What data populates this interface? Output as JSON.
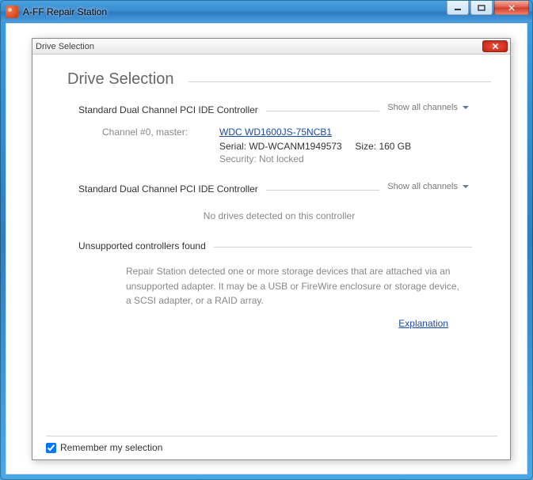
{
  "outer": {
    "title": "A-FF Repair Station"
  },
  "dialog": {
    "title": "Drive Selection",
    "heading": "Drive Selection",
    "controllers": [
      {
        "label": "Standard Dual Channel PCI IDE Controller",
        "show_all": "Show all channels",
        "channel": {
          "label": "Channel #0, master:",
          "model": "WDC WD1600JS-75NCB1",
          "serial_label": "Serial:",
          "serial": "WD-WCANM1949573",
          "size_label": "Size:",
          "size": "160 GB",
          "security_label": "Security:",
          "security": "Not locked"
        }
      },
      {
        "label": "Standard Dual Channel PCI IDE Controller",
        "show_all": "Show all channels",
        "empty_msg": "No drives detected on this controller"
      }
    ],
    "unsupported": {
      "label": "Unsupported controllers found",
      "body": "Repair Station detected one or more storage devices that are attached via an unsupported adapter. It may be a USB or FireWire enclosure or storage device, a SCSI adapter, or a RAID array.",
      "explanation": "Explanation"
    },
    "remember": "Remember my selection"
  }
}
